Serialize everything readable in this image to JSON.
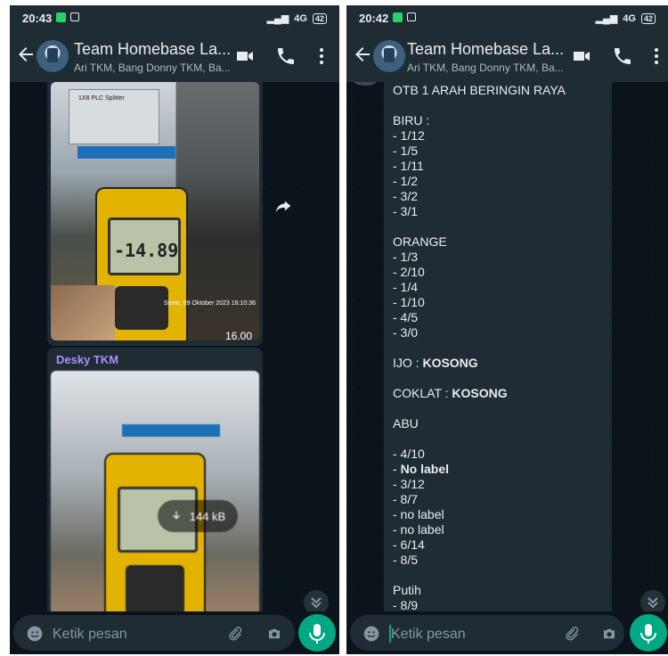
{
  "status": {
    "time_left": "20:43",
    "time_right": "20:42",
    "network": "4G",
    "battery": "42"
  },
  "chat": {
    "title": "Team Homebase La...",
    "participants": "Ari TKM, Bang Donny TKM, Ba..."
  },
  "left": {
    "photo1": {
      "splitter_label": "1X8 PLC Splitter",
      "meter_reading": "-14.89",
      "stamp_text": "Senin, 09 Oktober 2023 16:10:36",
      "time_overlay": "16.00"
    },
    "sender": "Desky TKM",
    "photo2": {
      "download_size": "144 kB"
    }
  },
  "right": {
    "lines": [
      "OTB 1 ARAH BERINGIN RAYA",
      "",
      "BIRU :",
      "- 1/12",
      "- 1/5",
      "- 1/11",
      "- 1/2",
      "- 3/2",
      "- 3/1",
      "",
      "ORANGE",
      "- 1/3",
      "- 2/10",
      "- 1/4",
      "- 1/10",
      "- 4/5",
      "- 3/0",
      "",
      "IJO : KOSONG",
      "",
      "COKLAT : KOSONG",
      "",
      "ABU",
      "",
      "- 4/10",
      "- No label",
      "- 3/12",
      "- 8/7",
      "- no label",
      "- no label",
      "- 6/14",
      "- 8/5",
      "",
      "Putih",
      "- 8/9"
    ]
  },
  "input": {
    "placeholder": "Ketik pesan"
  },
  "icons": [
    "back-arrow-icon",
    "video-call-icon",
    "phone-icon",
    "more-vertical-icon",
    "emoji-icon",
    "attach-icon",
    "camera-icon",
    "mic-icon",
    "forward-icon",
    "download-icon",
    "double-chevron-down-icon"
  ],
  "colors": {
    "header": "#1f2c34",
    "background": "#0b141a",
    "accent": "#00a884",
    "sender": "#a890ff"
  }
}
